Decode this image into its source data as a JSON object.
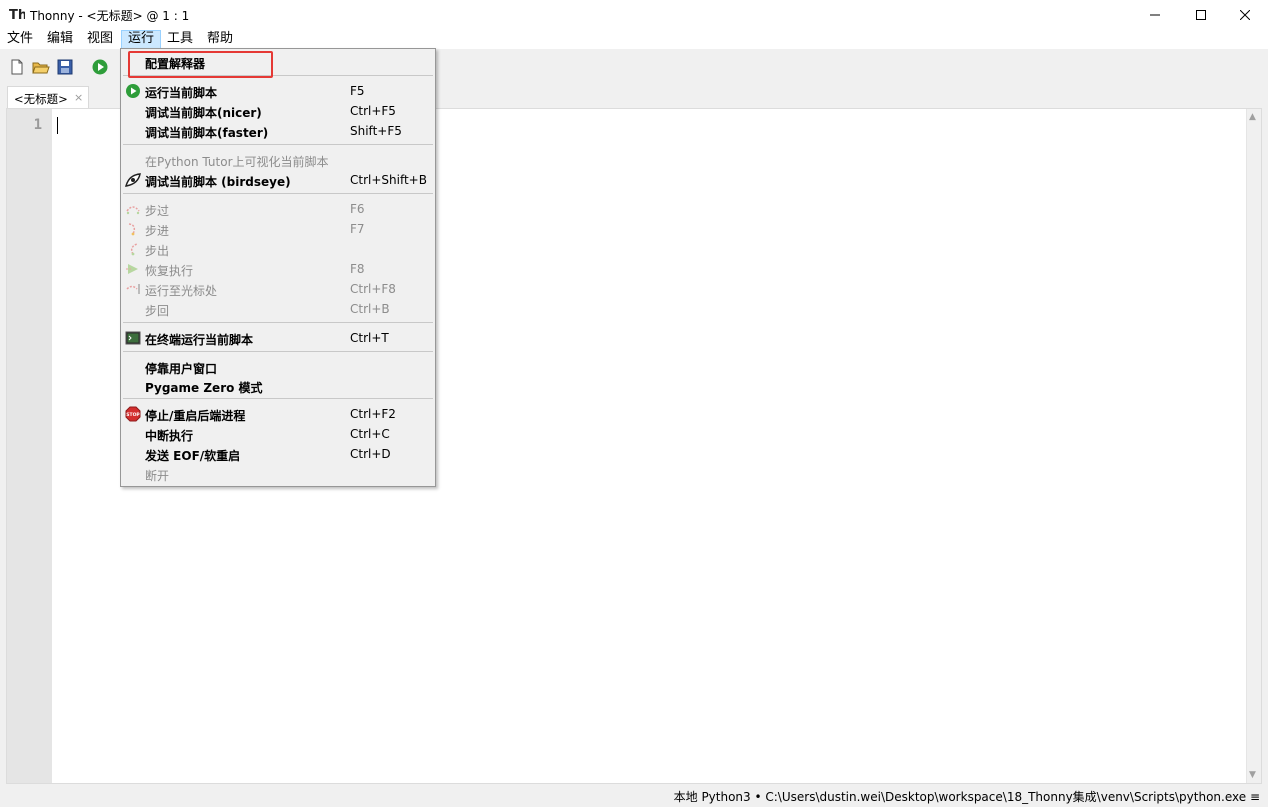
{
  "titlebar": {
    "title": "Thonny  -  <无标题>  @  1 : 1"
  },
  "menubar": {
    "items": [
      "文件",
      "编辑",
      "视图",
      "运行",
      "工具",
      "帮助"
    ],
    "active": "运行"
  },
  "editor": {
    "tab_label": "<无标题>",
    "tab_close": "×",
    "line_number": "1"
  },
  "run_menu": {
    "items": [
      {
        "label": "配置解释器",
        "shortcut": "",
        "enabled": true,
        "icon": ""
      },
      {
        "label": "运行当前脚本",
        "shortcut": "F5",
        "enabled": true,
        "icon": "run-icon"
      },
      {
        "label": "调试当前脚本(nicer)",
        "shortcut": "Ctrl+F5",
        "enabled": true,
        "icon": ""
      },
      {
        "label": "调试当前脚本(faster)",
        "shortcut": "Shift+F5",
        "enabled": true,
        "icon": ""
      },
      {
        "label": "在Python Tutor上可视化当前脚本",
        "shortcut": "",
        "enabled": false,
        "icon": ""
      },
      {
        "label": "调试当前脚本 (birdseye)",
        "shortcut": "Ctrl+Shift+B",
        "enabled": true,
        "icon": "birdseye-icon"
      },
      {
        "label": "步过",
        "shortcut": "F6",
        "enabled": false,
        "icon": "step-over-icon"
      },
      {
        "label": "步进",
        "shortcut": "F7",
        "enabled": false,
        "icon": "step-into-icon"
      },
      {
        "label": "步出",
        "shortcut": "",
        "enabled": false,
        "icon": "step-out-icon"
      },
      {
        "label": "恢复执行",
        "shortcut": "F8",
        "enabled": false,
        "icon": "resume-icon"
      },
      {
        "label": "运行至光标处",
        "shortcut": "Ctrl+F8",
        "enabled": false,
        "icon": "run-to-cursor-icon"
      },
      {
        "label": "步回",
        "shortcut": "Ctrl+B",
        "enabled": false,
        "icon": ""
      },
      {
        "label": "在终端运行当前脚本",
        "shortcut": "Ctrl+T",
        "enabled": true,
        "icon": "terminal-icon"
      },
      {
        "label": "停靠用户窗口",
        "shortcut": "",
        "enabled": true,
        "icon": ""
      },
      {
        "label": "Pygame Zero 模式",
        "shortcut": "",
        "enabled": true,
        "icon": ""
      },
      {
        "label": "停止/重启后端进程",
        "shortcut": "Ctrl+F2",
        "enabled": true,
        "icon": "stop-icon"
      },
      {
        "label": "中断执行",
        "shortcut": "Ctrl+C",
        "enabled": true,
        "icon": ""
      },
      {
        "label": "发送 EOF/软重启",
        "shortcut": "Ctrl+D",
        "enabled": true,
        "icon": ""
      },
      {
        "label": "断开",
        "shortcut": "",
        "enabled": false,
        "icon": ""
      }
    ]
  },
  "statusbar": {
    "text": "本地 Python3  •  C:\\Users\\dustin.wei\\Desktop\\workspace\\18_Thonny集成\\venv\\Scripts\\python.exe  ≡"
  },
  "colors": {
    "highlight": "#e53935",
    "run_green": "#2e9d3a",
    "stop_red": "#d32f2f"
  }
}
